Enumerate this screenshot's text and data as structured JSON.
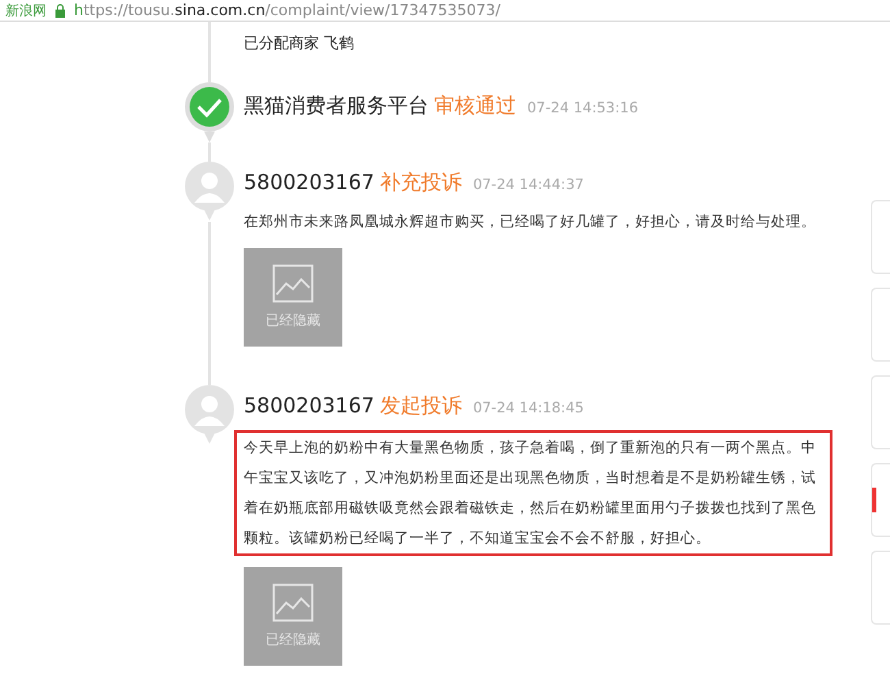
{
  "address_bar": {
    "site_name": "新浪网",
    "url": "https://tousu.**sina.com.cn**/complaint/view/17347535073/"
  },
  "timeline": [
    {
      "kind": "note",
      "text": "已分配商家 飞鹤"
    },
    {
      "kind": "verified",
      "author": "黑猫消费者服务平台",
      "action": "审核通过",
      "time": "07-24 14:53:16"
    },
    {
      "kind": "user",
      "author": "5800203167",
      "action": "补充投诉",
      "time": "07-24 14:44:37",
      "highlighted": false,
      "text": "在郑州市未来路凤凰城永辉超市购买，已经喝了好几罐了，好担心，请及时给与处理。",
      "images": [
        {
          "label": "已经隐藏"
        }
      ]
    },
    {
      "kind": "user",
      "author": "5800203167",
      "action": "发起投诉",
      "time": "07-24 14:18:45",
      "highlighted": true,
      "text": "今天早上泡的奶粉中有大量黑色物质，孩子急着喝，倒了重新泡的只有一两个黑点。中午宝宝又该吃了，又冲泡奶粉里面还是出现黑色物质，当时想着是不是奶粉罐生锈，试着在奶瓶底部用磁铁吸竟然会跟着磁铁走，然后在奶粉罐里面用勺子拨拨也找到了黑色颗粒。该罐奶粉已经喝了一半了，不知道宝宝会不会不舒服，好担心。",
      "images": [
        {
          "label": "已经隐藏"
        }
      ]
    }
  ]
}
